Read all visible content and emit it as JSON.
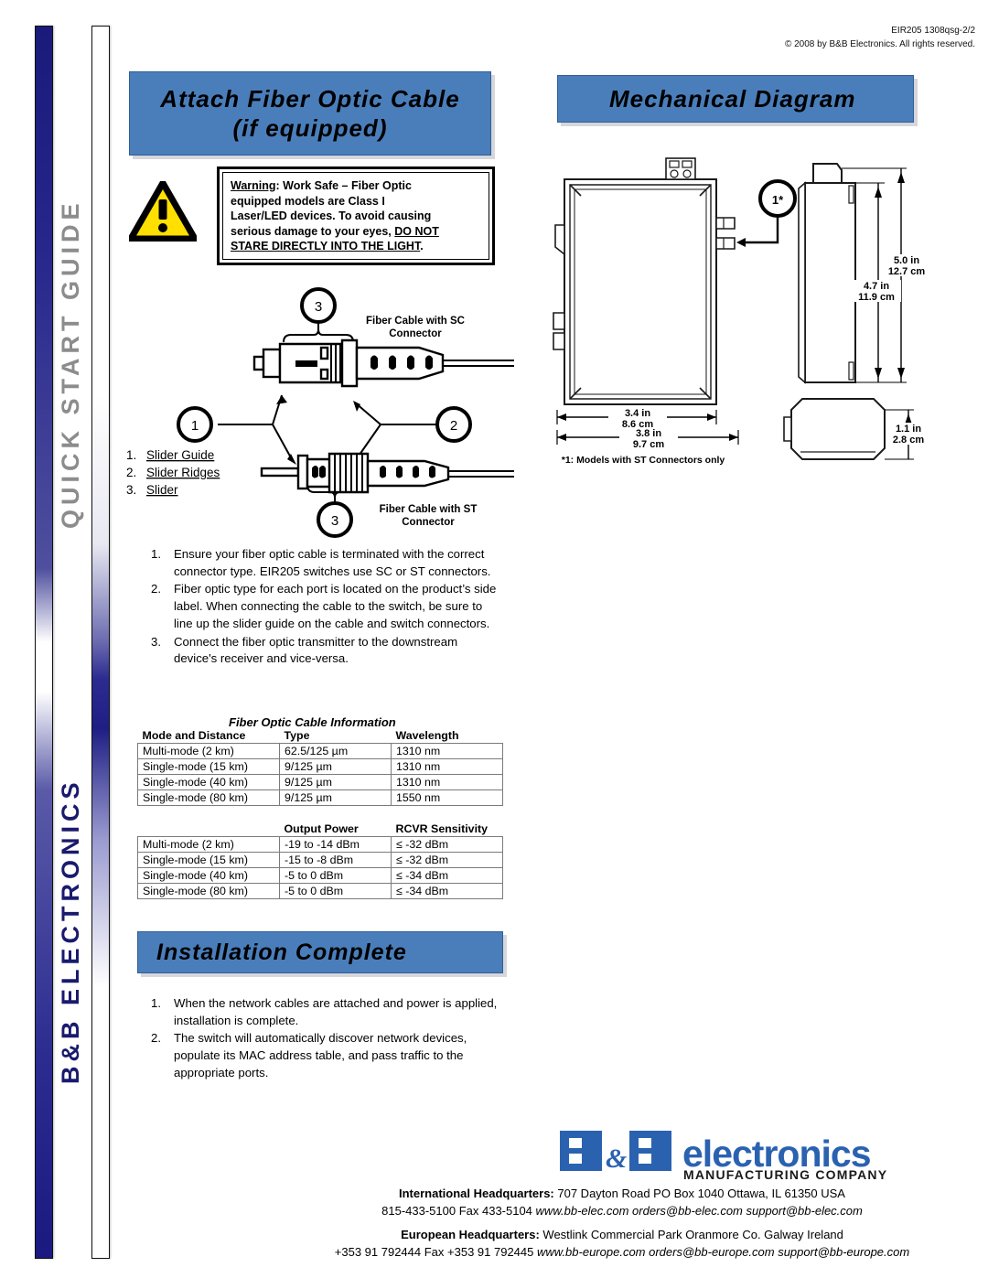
{
  "doc_meta": {
    "part_number": "EIR205 1308qsg-2/2",
    "copyright": "© 2008 by B&B Electronics. All rights reserved."
  },
  "side_rail": {
    "top_label": "QUICK START GUIDE",
    "bottom_label": "B&B ELECTRONICS",
    "top_label_color": "#8c8c8c",
    "bottom_label_color": "#1a1a6e"
  },
  "banners": {
    "attach_line1": "Attach Fiber Optic Cable",
    "attach_line2": "(if equipped)",
    "mechanical": "Mechanical Diagram",
    "install": "Installation Complete",
    "bg_color": "#4a7ebb"
  },
  "warning": {
    "label": "Warning",
    "line1_rest": ": Work Safe – Fiber Optic",
    "line2": "equipped models are Class I",
    "line3": "Laser/LED devices. To avoid causing",
    "line4a": "serious damage to your eyes, ",
    "line4b": "DO NOT",
    "line5": "STARE DIRECTLY INTO THE LIGHT",
    "line5_end": ".",
    "icon": "warning-triangle-icon",
    "triangle_color": "#ffe000"
  },
  "fiber_diagram": {
    "callout_sc_top": "3",
    "callout_left": "1",
    "callout_right": "2",
    "callout_st_bottom": "3",
    "label_sc_line1": "Fiber Cable with SC",
    "label_sc_line2": "Connector",
    "label_st_line1": "Fiber Cable with ST",
    "label_st_line2": "Connector",
    "legend": [
      {
        "num": "1.",
        "text": "Slider Guide"
      },
      {
        "num": "2.",
        "text": "Slider Ridges"
      },
      {
        "num": "3.",
        "text": "Slider"
      }
    ]
  },
  "fiber_steps": [
    {
      "num": "1.",
      "text": "Ensure your fiber optic cable is terminated with the correct connector type. EIR205 switches use SC or ST connectors."
    },
    {
      "num": "2.",
      "text": "Fiber optic type for each port is located on the product’s side label. When connecting the cable to the switch, be sure to line up the slider guide on the cable and switch connectors."
    },
    {
      "num": "3.",
      "text": "Connect the fiber optic transmitter to the downstream device's receiver and vice-versa."
    }
  ],
  "table_cable": {
    "title": "Fiber Optic Cable Information",
    "headers": [
      "Mode and Distance",
      "Type",
      "Wavelength"
    ],
    "rows": [
      [
        "Multi-mode (2 km)",
        "62.5/125 µm",
        "1310 nm"
      ],
      [
        "Single-mode (15 km)",
        "9/125 µm",
        "1310 nm"
      ],
      [
        "Single-mode (40 km)",
        "9/125 µm",
        "1310 nm"
      ],
      [
        "Single-mode (80 km)",
        "9/125 µm",
        "1550 nm"
      ]
    ]
  },
  "table_power": {
    "headers": [
      "",
      "Output Power",
      "RCVR Sensitivity"
    ],
    "rows": [
      [
        "Multi-mode (2 km)",
        "-19 to -14 dBm",
        "≤ -32 dBm"
      ],
      [
        "Single-mode (15 km)",
        "-15 to -8 dBm",
        "≤ -32 dBm"
      ],
      [
        "Single-mode (40 km)",
        "-5 to 0 dBm",
        "≤ -34 dBm"
      ],
      [
        "Single-mode (80 km)",
        "-5 to 0 dBm",
        "≤ -34 dBm"
      ]
    ]
  },
  "install_steps": [
    {
      "num": "1.",
      "text": "When the network cables are attached and power is applied, installation is complete."
    },
    {
      "num": "2.",
      "text": "The switch will automatically discover network devices, populate its MAC address table, and pass traffic to the appropriate ports."
    }
  ],
  "mechanical": {
    "callout_1": "1*",
    "dim_width_in": "3.4 in",
    "dim_width_cm": "8.6 cm",
    "dim_width2_in": "3.8 in",
    "dim_width2_cm": "9.7 cm",
    "dim_height_in": "5.0 in",
    "dim_height_cm": "12.7 cm",
    "dim_height2_in": "4.7 in",
    "dim_height2_cm": "11.9 cm",
    "dim_depth_in": "1.1 in",
    "dim_depth_cm": "2.8 cm",
    "note": "*1: Models with ST Connectors only"
  },
  "logo": {
    "b_text": "B",
    "amp_text": "&",
    "word": "electronics",
    "tagline": "MANUFACTURING  COMPANY",
    "color": "#2a62b0"
  },
  "footer": {
    "intl_label": "International Headquarters:",
    "intl_address": " 707 Dayton Road PO Box 1040 Ottawa, IL 61350 USA",
    "intl_phone": "815-433-5100 Fax 433-5104",
    "intl_web": "www.bb-elec.com  orders@bb-elec.com  support@bb-elec.com",
    "eu_label": "European Headquarters:",
    "eu_address": " Westlink Commercial Park  Oranmore Co. Galway Ireland",
    "eu_phone": "+353 91 792444  Fax +353 91 792445",
    "eu_web": "www.bb-europe.com  orders@bb-europe.com support@bb-europe.com"
  }
}
